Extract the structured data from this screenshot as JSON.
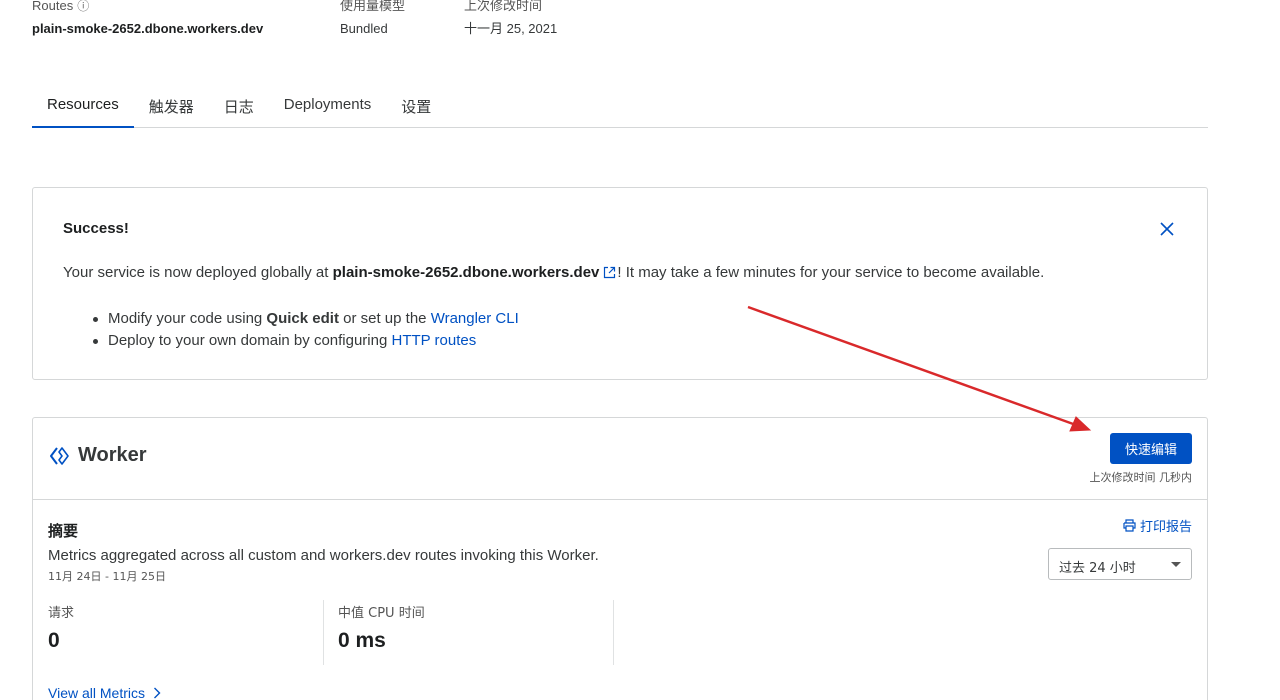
{
  "meta": {
    "routes_label": "Routes",
    "routes_value": "plain-smoke-2652.dbone.workers.dev",
    "usage_label": "使用量模型",
    "usage_value": "Bundled",
    "modified_label": "上次修改时间",
    "modified_value": "十一月 25, 2021"
  },
  "tabs": [
    "Resources",
    "触发器",
    "日志",
    "Deployments",
    "设置"
  ],
  "banner": {
    "title": "Success!",
    "text_before": "Your service is now deployed globally at ",
    "domain": "plain-smoke-2652.dbone.workers.dev",
    "text_after": "! It may take a few minutes for your service to become available.",
    "item1_before": "Modify your code using ",
    "item1_bold": "Quick edit",
    "item1_mid": " or set up the ",
    "item1_link": "Wrangler CLI",
    "item2_before": "Deploy to your own domain by configuring ",
    "item2_link": "HTTP routes"
  },
  "worker": {
    "title": "Worker",
    "quick_edit": "快速编辑",
    "last_modified": "上次修改时间 几秒内",
    "summary_title": "摘要",
    "summary_desc": "Metrics aggregated across all custom and workers.dev routes invoking this Worker.",
    "summary_date": "11月 24日 - 11月 25日",
    "print_report": "打印报告",
    "range": "过去 24 小时",
    "metrics": [
      {
        "label": "请求",
        "value": "0"
      },
      {
        "label": "中值 CPU 时间",
        "value": "0 ms"
      }
    ],
    "view_all": "View all Metrics"
  },
  "colors": {
    "accent": "#0051c3",
    "annotation_arrow": "#d9292b"
  }
}
